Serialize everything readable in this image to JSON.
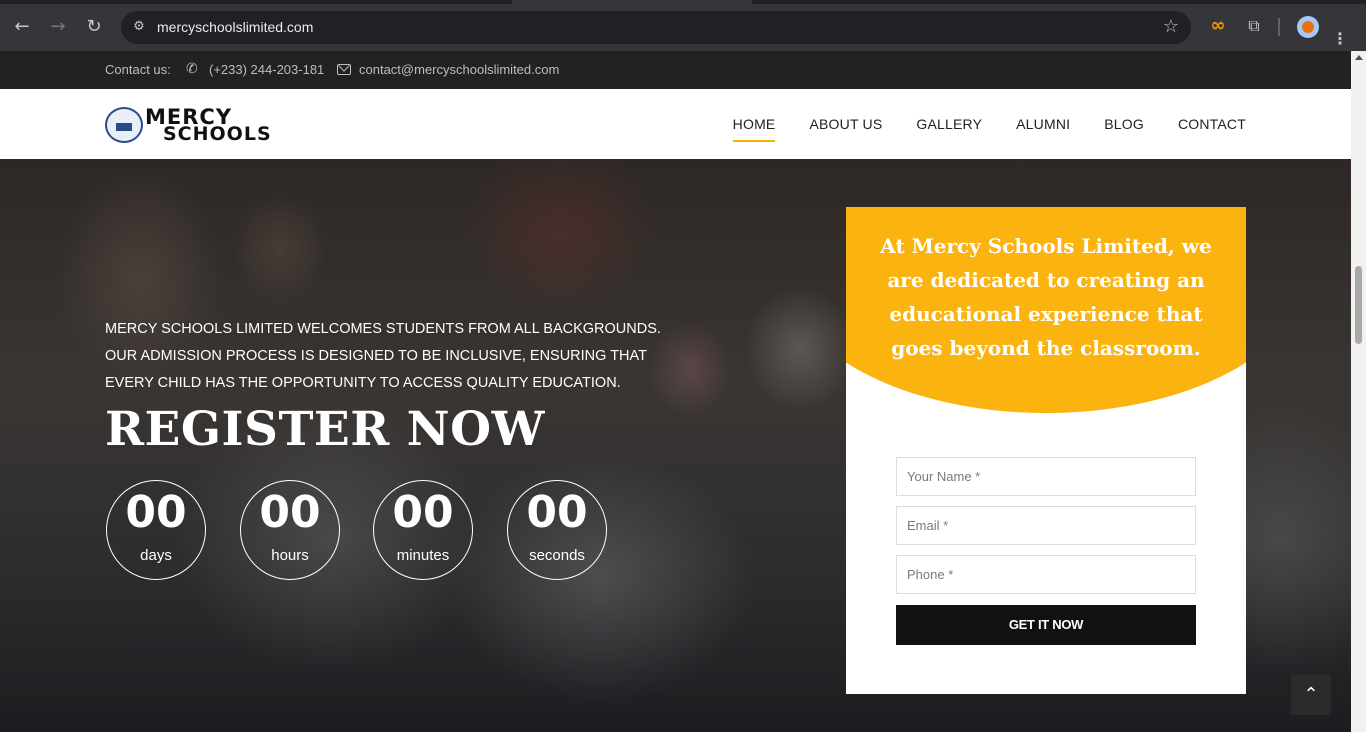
{
  "browser": {
    "url": "mercyschoolslimited.com"
  },
  "topbar": {
    "contact_label": "Contact us:",
    "phone": "(+233) 244-203-181",
    "email": "contact@mercyschoolslimited.com"
  },
  "logo": {
    "line1": "MERCY",
    "line2": "SCHOOLS"
  },
  "nav": {
    "items": [
      {
        "label": "HOME",
        "active": true
      },
      {
        "label": "ABOUT US"
      },
      {
        "label": "GALLERY"
      },
      {
        "label": "ALUMNI"
      },
      {
        "label": "BLOG"
      },
      {
        "label": "CONTACT"
      }
    ]
  },
  "hero": {
    "intro": "MERCY SCHOOLS LIMITED WELCOMES STUDENTS FROM ALL BACKGROUNDS. OUR ADMISSION PROCESS IS DESIGNED TO BE INCLUSIVE, ENSURING THAT EVERY CHILD HAS THE OPPORTUNITY TO ACCESS QUALITY EDUCATION.",
    "heading": "REGISTER NOW",
    "countdown": [
      {
        "value": "00",
        "unit": "days"
      },
      {
        "value": "00",
        "unit": "hours"
      },
      {
        "value": "00",
        "unit": "minutes"
      },
      {
        "value": "00",
        "unit": "seconds"
      }
    ]
  },
  "form": {
    "tagline": "At Mercy Schools Limited, we are dedicated to creating an educational experience that goes beyond the classroom.",
    "name_placeholder": "Your Name *",
    "email_placeholder": "Email *",
    "phone_placeholder": "Phone *",
    "submit_label": "GET IT NOW"
  },
  "colors": {
    "accent": "#fbb40f",
    "dark": "#111111"
  }
}
